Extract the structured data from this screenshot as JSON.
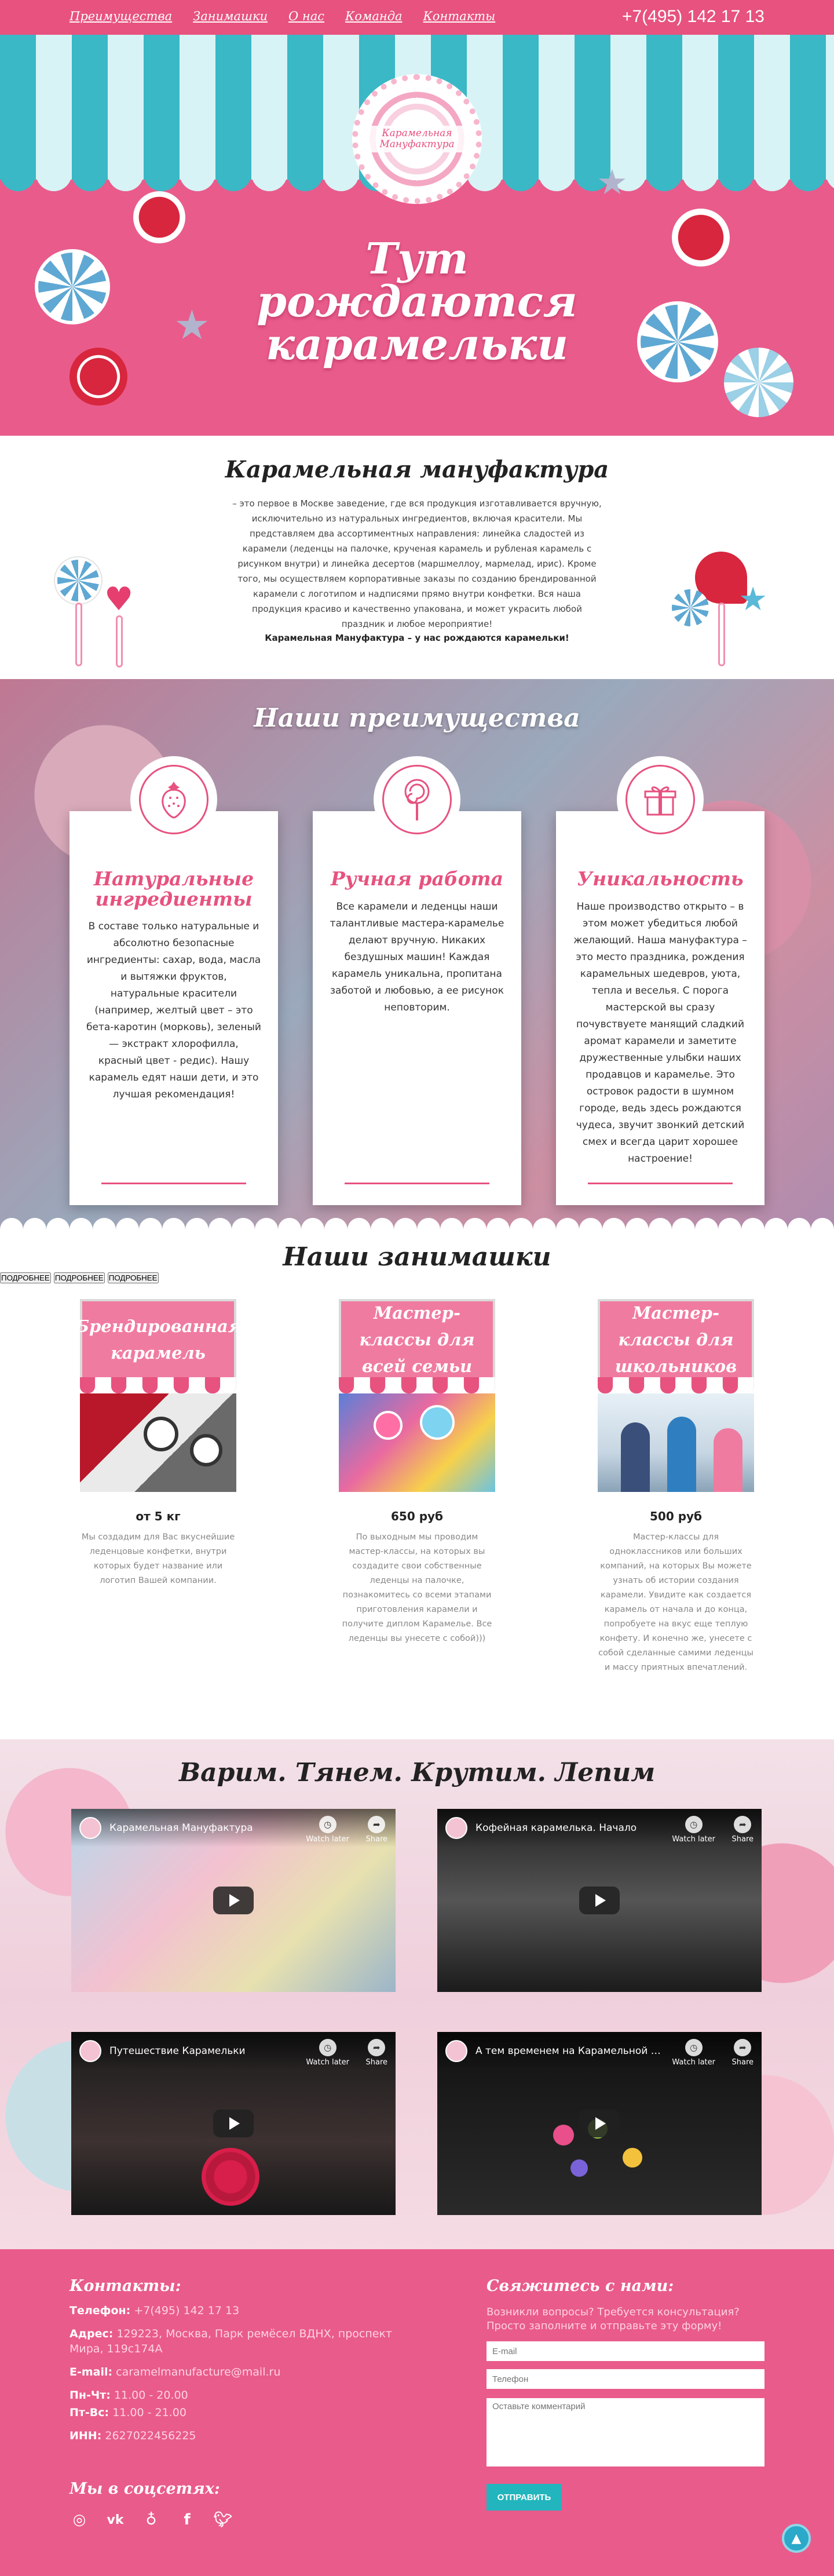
{
  "nav": {
    "items": [
      "Преимущества",
      "Занимашки",
      "О нас",
      "Команда",
      "Контакты"
    ],
    "phone": "+7(495) 142 17 13"
  },
  "logo": {
    "text": "Карамельная Мануфактура"
  },
  "hero": {
    "title_lines": [
      "Тут",
      "рождаются",
      "карамельки"
    ]
  },
  "about": {
    "title": "Карамельная мануфактура",
    "text": "– это первое в Москве заведение, где вся продукция изготавливается вручную, исключительно из натуральных ингредиентов, включая красители. Мы представляем два ассортиментных направления: линейка сладостей из карамели (леденцы на палочке, крученая карамель и рубленая карамель с рисунком внутри) и линейка десертов (маршмеллоу, мармелад, ирис). Кроме того, мы осуществляем корпоративные заказы по созданию брендированной карамели с логотипом и надписями прямо внутри конфетки. Вся наша продукция красиво и качественно упакована, и может украсить любой праздник и любое мероприятие!",
    "slogan": "Карамельная Мануфактура – у нас рождаются карамельки!"
  },
  "advantages": {
    "title": "Наши преимущества",
    "cards": [
      {
        "icon": "strawberry-icon",
        "title": "Натуральные ингредиенты",
        "text": "В составе только натуральные и абсолютно безопасные ингредиенты: сахар, вода, масла и вытяжки фруктов, натуральные красители (например, желтый цвет – это бета-каротин (морковь), зеленый — экстракт хлорофилла, красный цвет - редис). Нашу карамель едят наши дети, и это лучшая рекомендация!"
      },
      {
        "icon": "lollipop-icon",
        "title": "Ручная работа",
        "text": "Все карамели и леденцы наши талантливые мастера-карамелье делают вручную. Никаких бездушных машин! Каждая карамель уникальна, пропитана заботой и любовью, а ее рисунок неповторим."
      },
      {
        "icon": "gift-icon",
        "title": "Уникальность",
        "text": "Наше производство открыто – в этом может убедиться любой желающий. Наша мануфактура – это место праздника, рождения карамельных шедевров, уюта, тепла и веселья. С порога мастерской вы сразу почувствуете манящий сладкий аромат карамели и заметите дружественные улыбки наших продавцов и карамелье. Это островок радости в шумном городе, ведь здесь рождаются чудеса, звучит звонкий детский смех и всегда царит хорошее настроение!"
      }
    ]
  },
  "activities": {
    "title": "Наши занимашки",
    "items": [
      {
        "title": "Брендированная карамель",
        "price": "от 5 кг",
        "desc": "Мы создадим для Вас вкуснейшие леденцовые конфетки, внутри которых будет название или логотип Вашей компании.",
        "button": "ПОДРОБНЕЕ"
      },
      {
        "title": "Мастер-классы для всей семьи",
        "price": "650 руб",
        "desc": "По выходным мы проводим мастер-классы, на которых вы создадите свои собственные леденцы на палочке, познакомитесь со всеми этапами приготовления карамели и получите диплом Карамелье. Все леденцы вы унесете с собой)))",
        "button": "ПОДРОБНЕЕ"
      },
      {
        "title": "Мастер-классы для школьников",
        "price": "500 руб",
        "desc": "Мастер-классы для одноклассников или больших компаний, на которых Вы можете узнать об истории создания карамели. Увидите как создается карамель от начала и до конца, попробуете на вкус еще теплую конфету. И конечно же, унесете с собой сделанные самими леденцы и массу приятных впечатлений.",
        "button": "ПОДРОБНЕЕ"
      }
    ]
  },
  "videos": {
    "title": "Варим. Тянем. Крутим. Лепим",
    "watch_later": "Watch later",
    "share": "Share",
    "items": [
      {
        "title": "Карамельная Мануфактура"
      },
      {
        "title": "Кофейная карамелька. Начало"
      },
      {
        "title": "Путешествие Карамельки"
      },
      {
        "title": "А тем временем на Карамельной Ма..."
      }
    ]
  },
  "footer": {
    "contacts_title": "Контакты:",
    "phone_label": "Телефон:",
    "phone": "+7(495) 142 17 13",
    "address_label": "Адрес:",
    "address": "129223, Москва, Парк ремёсел ВДНХ, проспект Мира, 119с174А",
    "email_label": "E-mail:",
    "email": "caramelmanufacture@mail.ru",
    "hours1_label": "Пн-Чт:",
    "hours1": "11.00 - 20.00",
    "hours2_label": "Пт-Вс:",
    "hours2": "11.00 - 21.00",
    "inn_label": "ИНН:",
    "inn": "2627022456225",
    "social_title": "Мы в соцсетях:",
    "form_title": "Свяжитесь с нами:",
    "form_hint": "Возникли вопросы? Требуется консультация? Просто заполните и отправьте эту форму!",
    "email_placeholder": "E-mail",
    "phone_placeholder": "Телефон",
    "comment_placeholder": "Оставьте комментарий",
    "send": "ОТПРАВИТЬ"
  }
}
